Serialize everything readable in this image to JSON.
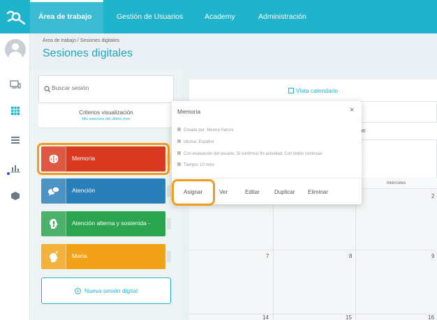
{
  "topnav": {
    "items": [
      {
        "label": "Área de trabajo",
        "active": true
      },
      {
        "label": "Gestión de Usuarios",
        "active": false
      },
      {
        "label": "Academy",
        "active": false
      },
      {
        "label": "Administración",
        "active": false
      }
    ]
  },
  "header": {
    "breadcrumb": "Área de trabajo  /  Sesiones digitales",
    "title": "Sesiones digitales"
  },
  "search": {
    "placeholder": "Buscar sesión"
  },
  "criteria": {
    "title": "Criterios visualización",
    "subtitle": "Mis sesiones del último mes"
  },
  "sessions": [
    {
      "label": "Memoria",
      "color": "#d8391f",
      "icon": "brain-icon"
    },
    {
      "label": "Atención",
      "color": "#2b7fb9",
      "icon": "chat-bubbles-icon"
    },
    {
      "label": "Atención alterna y sostenida -",
      "color": "#2aa44f",
      "icon": "head-exclamation-icon"
    },
    {
      "label": "María",
      "color": "#f1a219",
      "icon": "head-music-icon"
    }
  ],
  "new_session_label": "Nueva sesión digital",
  "calendar": {
    "tab_label": "Vista calendario",
    "select_label": "sión",
    "weekday": "miércoles",
    "days": [
      "2",
      "7",
      "8",
      "9",
      "14",
      "15",
      "16"
    ]
  },
  "popup": {
    "title": "Memoria",
    "close": "×",
    "details": [
      "Creada por: Merina Haruni",
      "Idioma: Español",
      "Con evaluación del usuario,  Si confirmar fin actividad,  Con botón continuar",
      "Tiempo: 10 mins"
    ],
    "buttons": {
      "assign": "Asignar",
      "view": "Ver",
      "edit": "Editar",
      "duplicate": "Duplicar",
      "delete": "Eliminar"
    }
  },
  "colors": {
    "brand": "#1fb3cc",
    "highlight": "#f39c1a"
  }
}
